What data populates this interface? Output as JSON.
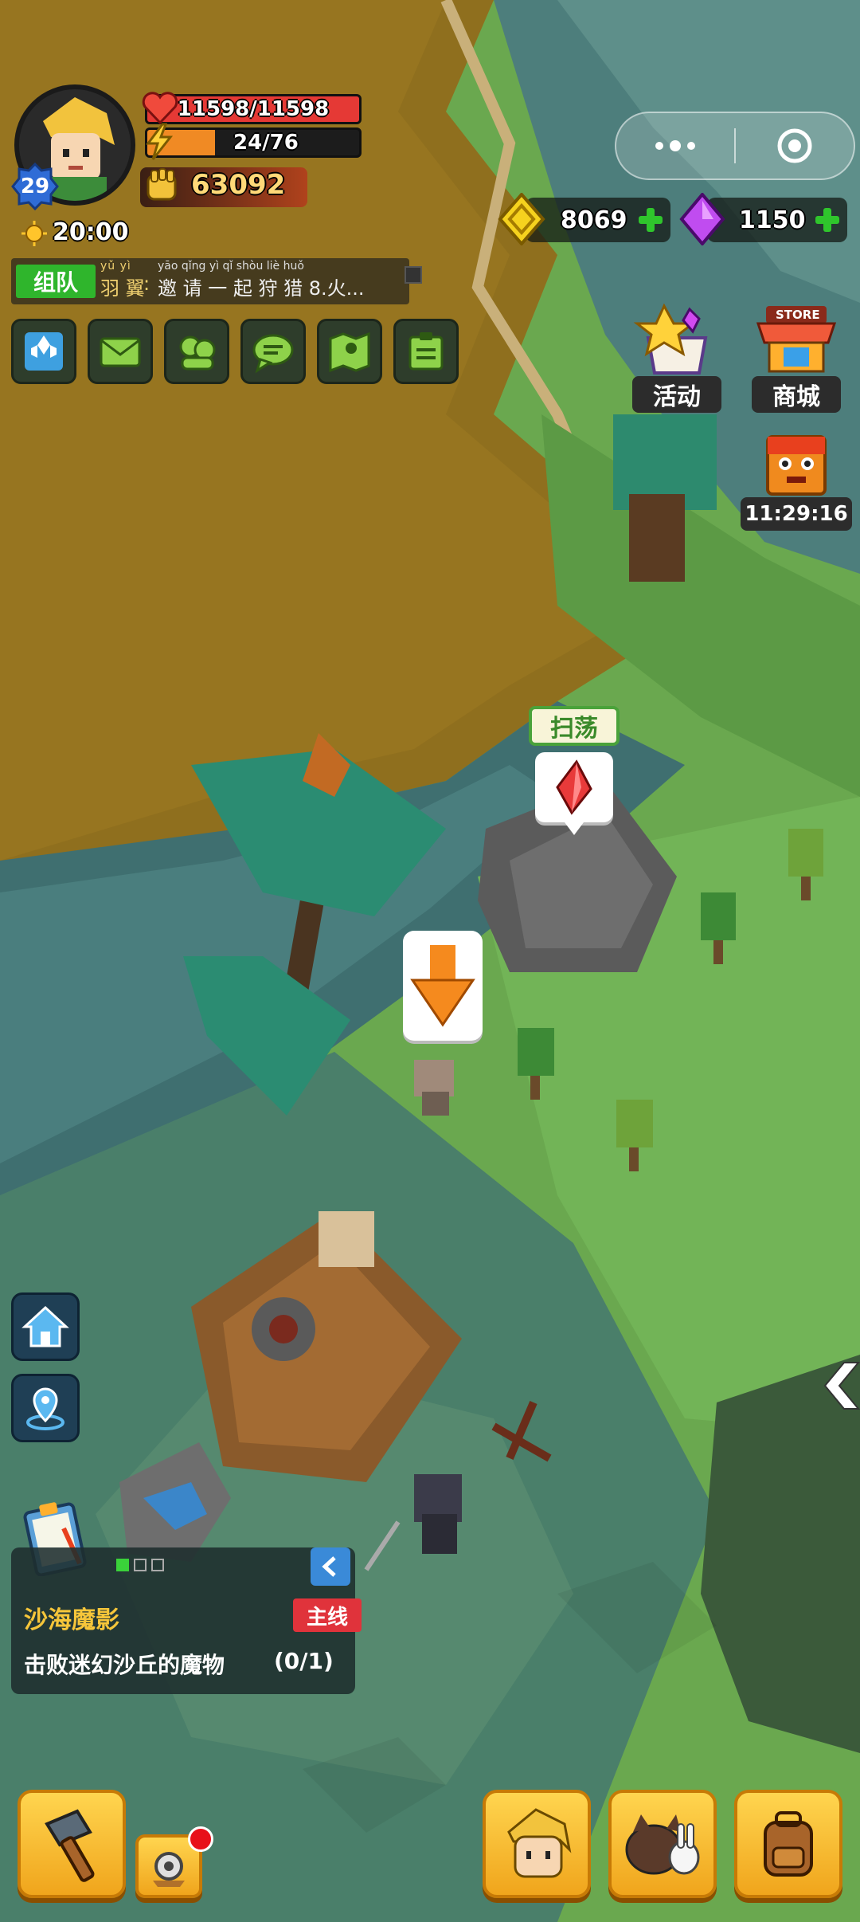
{
  "player": {
    "level": "29",
    "hp": "11598/11598",
    "hp_fraction": 1.0,
    "energy": "24/76",
    "energy_fraction": 0.32,
    "power": "63092",
    "time": "20:00"
  },
  "chat": {
    "channel": "组队",
    "sender": "羽 翼",
    "sender_pinyin": "yǔ yì",
    "message": "邀 请 一 起 狩 猎 8.火...",
    "message_pinyin": "yāo qǐng yì qǐ shòu liè     huǒ"
  },
  "menu_icons": [
    "map-tiles-icon",
    "mail-icon",
    "friends-icon",
    "chat-icon",
    "world-map-icon",
    "task-board-icon"
  ],
  "currency": {
    "gold": "8069",
    "gems": "1150"
  },
  "side_buttons": {
    "events_label": "活动",
    "store_label": "商城",
    "store_sign": "STORE",
    "timer": "11:29:16"
  },
  "world": {
    "sweep_label": "扫荡"
  },
  "quest": {
    "title": "沙海魔影",
    "tag": "主线",
    "description": "击败迷幻沙丘的魔物",
    "progress": "(0/1)",
    "page_count": 3,
    "active_page": 1
  },
  "colors": {
    "sand": "#8f6f1e",
    "grass": "#6aa84f",
    "water": "#3f6f70",
    "hp": "#e53935",
    "energy": "#f08a24",
    "accent_green": "#2fc52c",
    "tag_red": "#e0333b"
  }
}
